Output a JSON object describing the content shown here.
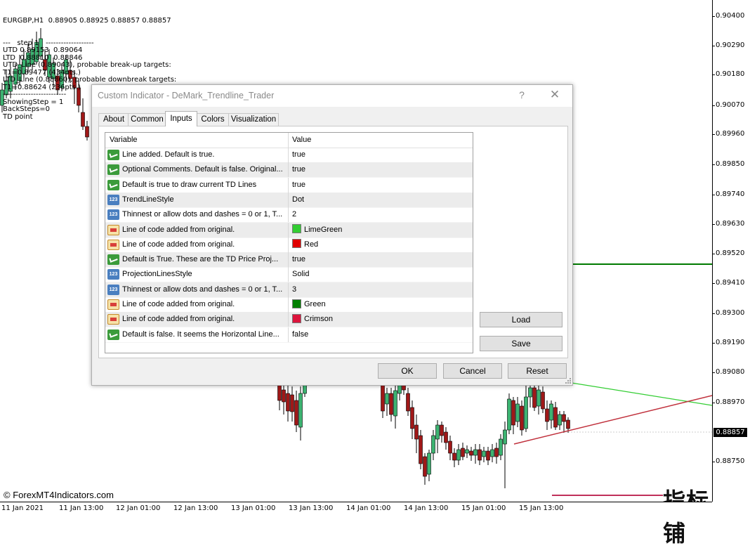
{
  "chart": {
    "symbol_line": "EURGBP,H1  0.88905 0.88925 0.88857 0.88857",
    "info_lines": [
      "---   step 1   -------------------",
      "UTD 0.89153  0.89064",
      "LTD  0.88810  0.88846",
      "UTD_Line (0.89043), probable break-up targets:",
      "T1=0.89477 (434pts.)",
      "LTD_Line (0.88860), probable downbreak targets:",
      "T1=0.88624 (236pts.)",
      "-------------------------",
      "ShowingStep = 1",
      "BackSteps=0",
      "TD point"
    ],
    "price_ticks": [
      "0.90400",
      "0.90290",
      "0.90180",
      "0.90070",
      "0.89960",
      "0.89850",
      "0.89740",
      "0.89630",
      "0.89520",
      "0.89410",
      "0.89300",
      "0.89190",
      "0.89080",
      "0.88970",
      "0.88750"
    ],
    "current_price": "0.88857",
    "time_ticks": [
      "11 Jan 2021",
      "11 Jan 13:00",
      "12 Jan 01:00",
      "12 Jan 13:00",
      "13 Jan 01:00",
      "13 Jan 13:00",
      "14 Jan 01:00",
      "14 Jan 13:00",
      "15 Jan 01:00",
      "15 Jan 13:00"
    ],
    "copyright": "© ForexMT4Indicators.com",
    "watermark": "指标铺",
    "colors": {
      "bull": "#3cb371",
      "bear": "#a01818",
      "target_green": "#007a00",
      "trend_green": "#32cd32",
      "trend_red": "#c0303c",
      "lower_line": "#c0305a"
    }
  },
  "dialog": {
    "title": "Custom Indicator - DeMark_Trendline_Trader",
    "help_label": "?",
    "close_label": "✕",
    "tabs": [
      {
        "label": "About"
      },
      {
        "label": "Common"
      },
      {
        "label": "Inputs"
      },
      {
        "label": "Colors"
      },
      {
        "label": "Visualization"
      }
    ],
    "active_tab": "Inputs",
    "columns": {
      "variable": "Variable",
      "value": "Value"
    },
    "rows": [
      {
        "icon": "bool",
        "variable": "Line added.  Default is true.",
        "value": "true"
      },
      {
        "icon": "bool",
        "variable": "Optional Comments.  Default is false. Original...",
        "value": "true"
      },
      {
        "icon": "bool",
        "variable": "Default is true to draw current TD Lines",
        "value": "true"
      },
      {
        "icon": "num",
        "variable": "TrendLineStyle",
        "value": "Dot"
      },
      {
        "icon": "num",
        "variable": "Thinnest or allow dots and dashes = 0 or 1, T...",
        "value": "2"
      },
      {
        "icon": "color",
        "variable": "Line of code added from original.",
        "value": "LimeGreen",
        "swatch": "#32cd32"
      },
      {
        "icon": "color",
        "variable": "Line of code added from original.",
        "value": "Red",
        "swatch": "#e00000"
      },
      {
        "icon": "bool",
        "variable": "Default is True.  These are the TD Price Proj...",
        "value": "true"
      },
      {
        "icon": "num",
        "variable": "ProjectionLinesStyle",
        "value": "Solid"
      },
      {
        "icon": "num",
        "variable": "Thinnest or allow dots and dashes = 0 or 1, T...",
        "value": "3"
      },
      {
        "icon": "color",
        "variable": "Line of code added from original.",
        "value": "Green",
        "swatch": "#008000"
      },
      {
        "icon": "color",
        "variable": "Line of code added from original.",
        "value": "Crimson",
        "swatch": "#dc143c"
      },
      {
        "icon": "bool",
        "variable": "Default is false.  It seems the Horizontal Line...",
        "value": "false"
      }
    ],
    "icon_num_text": "123",
    "side_buttons": {
      "load": "Load",
      "save": "Save"
    },
    "bottom_buttons": {
      "ok": "OK",
      "cancel": "Cancel",
      "reset": "Reset"
    }
  }
}
